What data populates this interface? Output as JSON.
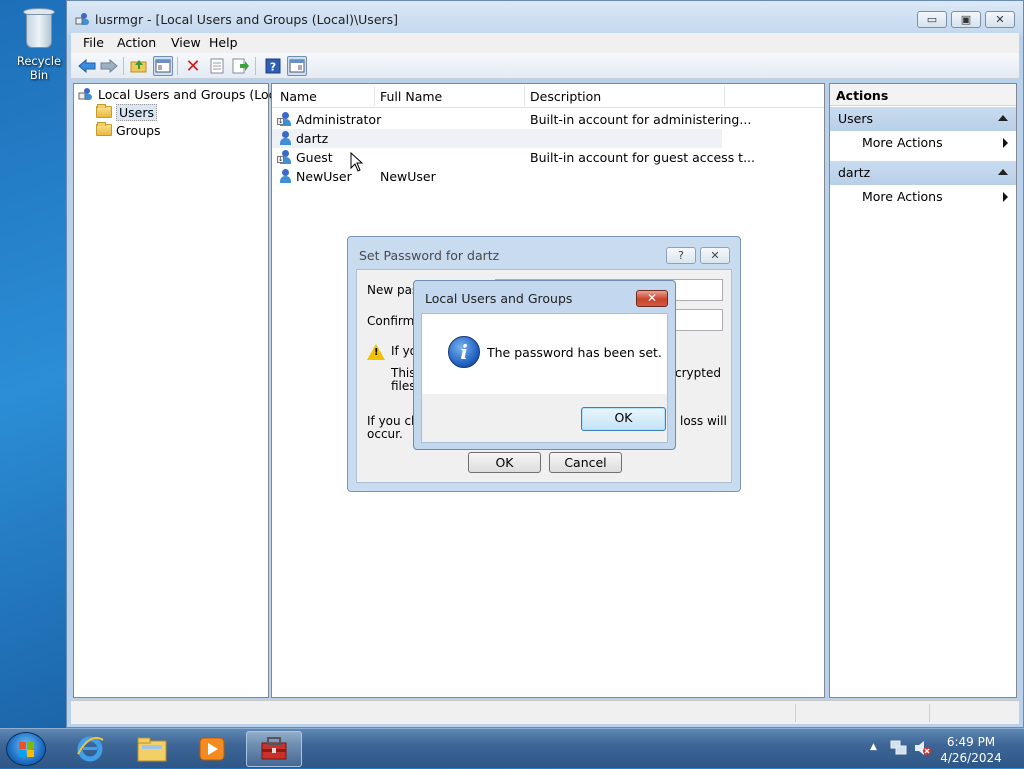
{
  "desktop": {
    "recycle_bin_label": "Recycle Bin"
  },
  "window": {
    "title": "lusrmgr - [Local Users and Groups (Local)\\Users]",
    "min_glyph": "▭",
    "max_glyph": "▣",
    "close_glyph": "✕"
  },
  "menu": {
    "items": [
      "File",
      "Action",
      "View",
      "Help"
    ]
  },
  "toolbar": {
    "icons": [
      "back-arrow-icon",
      "forward-arrow-icon",
      "up-folder-icon",
      "show-hide-tree-icon",
      "delete-icon",
      "properties-icon",
      "export-list-icon",
      "help-icon",
      "show-hide-action-pane-icon"
    ]
  },
  "tree": {
    "root_label": "Local Users and Groups (Local)",
    "items": [
      {
        "label": "Users",
        "selected": true
      },
      {
        "label": "Groups",
        "selected": false
      }
    ]
  },
  "list": {
    "columns": [
      "Name",
      "Full Name",
      "Description"
    ],
    "rows": [
      {
        "name": "Administrator",
        "full_name": "",
        "description": "Built-in account for administering..."
      },
      {
        "name": "dartz",
        "full_name": "",
        "description": ""
      },
      {
        "name": "Guest",
        "full_name": "",
        "description": "Built-in account for guest access t..."
      },
      {
        "name": "NewUser",
        "full_name": "NewUser",
        "description": ""
      }
    ]
  },
  "actions": {
    "title": "Actions",
    "sections": [
      {
        "header": "Users",
        "item": "More Actions"
      },
      {
        "header": "dartz",
        "item": "More Actions"
      }
    ]
  },
  "set_password_dialog": {
    "title": "Set Password for dartz",
    "help_glyph": "?",
    "close_glyph": "✕",
    "new_password_label": "New pass",
    "confirm_password_label": "Confirm pa",
    "warning_line1": "If you",
    "warning_line2": "This",
    "warning_line2_right": "crypted",
    "warning_line3": "files,",
    "consequence_left_1": "If you click",
    "consequence_left_2": "occur.",
    "consequence_right": "loss will",
    "ok_label": "OK",
    "cancel_label": "Cancel"
  },
  "message_box": {
    "title": "Local Users and Groups",
    "close_glyph": "✕",
    "icon_glyph": "i",
    "message": "The password has been set.",
    "ok_label": "OK"
  },
  "taskbar": {
    "apps": [
      "internet-explorer-icon",
      "windows-explorer-icon",
      "media-player-icon",
      "computer-management-icon"
    ],
    "active_app": "computer-management-icon"
  },
  "tray": {
    "time": "6:49 PM",
    "date": "4/26/2024"
  }
}
